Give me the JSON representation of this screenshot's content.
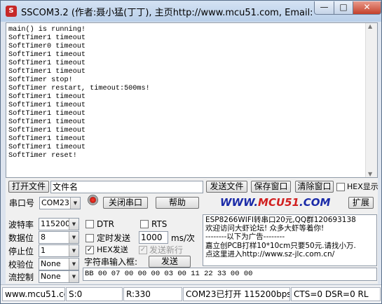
{
  "window": {
    "icon_glyph": "S",
    "title": "SSCOM3.2 (作者:聂小猛(丁丁), 主页http://www.mcu51.com,  Email: mc...",
    "min_glyph": "—",
    "max_glyph": "□",
    "close_glyph": "✕"
  },
  "receive": {
    "text": "main() is running!\nSoftTimer1 timeout\nSoftTimer0 timeout\nSoftTimer1 timeout\nSoftTimer1 timeout\nSoftTimer1 timeout\nSoftTimer stop!\nSoftTimer restart, timeout:500ms!\nSoftTimer1 timeout\nSoftTimer1 timeout\nSoftTimer1 timeout\nSoftTimer1 timeout\nSoftTimer1 timeout\nSoftTimer1 timeout\nSoftTimer1 timeout\nSoftTimer reset!"
  },
  "toolbar": {
    "open_file": "打开文件",
    "filename": "文件名",
    "send_file": "发送文件",
    "save_window": "保存窗口",
    "clear_window": "清除窗口",
    "hex_display": "HEX显示",
    "port_label": "串口号",
    "port_value": "COM23",
    "close_port": "关闭串口",
    "help": "帮助",
    "expand": "扩展"
  },
  "logo": {
    "prefix": "WWW.",
    "brand": "MCU51",
    "suffix": ".COM"
  },
  "settings": {
    "baud_label": "波特率",
    "baud_value": "115200",
    "databits_label": "数据位",
    "databits_value": "8",
    "stopbits_label": "停止位",
    "stopbits_value": "1",
    "parity_label": "校验位",
    "parity_value": "None",
    "flow_label": "流控制",
    "flow_value": "None"
  },
  "options": {
    "dtr": "DTR",
    "rts": "RTS",
    "timed_send": "定时发送",
    "interval_value": "1000",
    "interval_unit": "ms/次",
    "hex_send": "HEX发送",
    "hex_send_checked_glyph": "✓",
    "send_newline": "发送新行",
    "input_label": "字符串输入框:",
    "send": "发送",
    "send_input": "BB 00 07 00 00 00 03 00 11 22 33 00 00"
  },
  "ad": {
    "lines": [
      "ESP8266WIFI转串口20元,QQ群120693138",
      "欢迎访问大虾论坛! 众多大虾等着你!",
      "--------以下为广告--------",
      "嘉立创PCB打样10*10cm只要50元.请找小万.",
      "点这里进入http://www.sz-jlc.com.cn/"
    ]
  },
  "status": {
    "site": "www.mcu51.cor",
    "sent": "S:0",
    "received": "R:330",
    "port_state": "COM23已打开  115200bps",
    "signals": "CTS=0 DSR=0 RL"
  },
  "icons": {
    "dropdown": "▼"
  }
}
